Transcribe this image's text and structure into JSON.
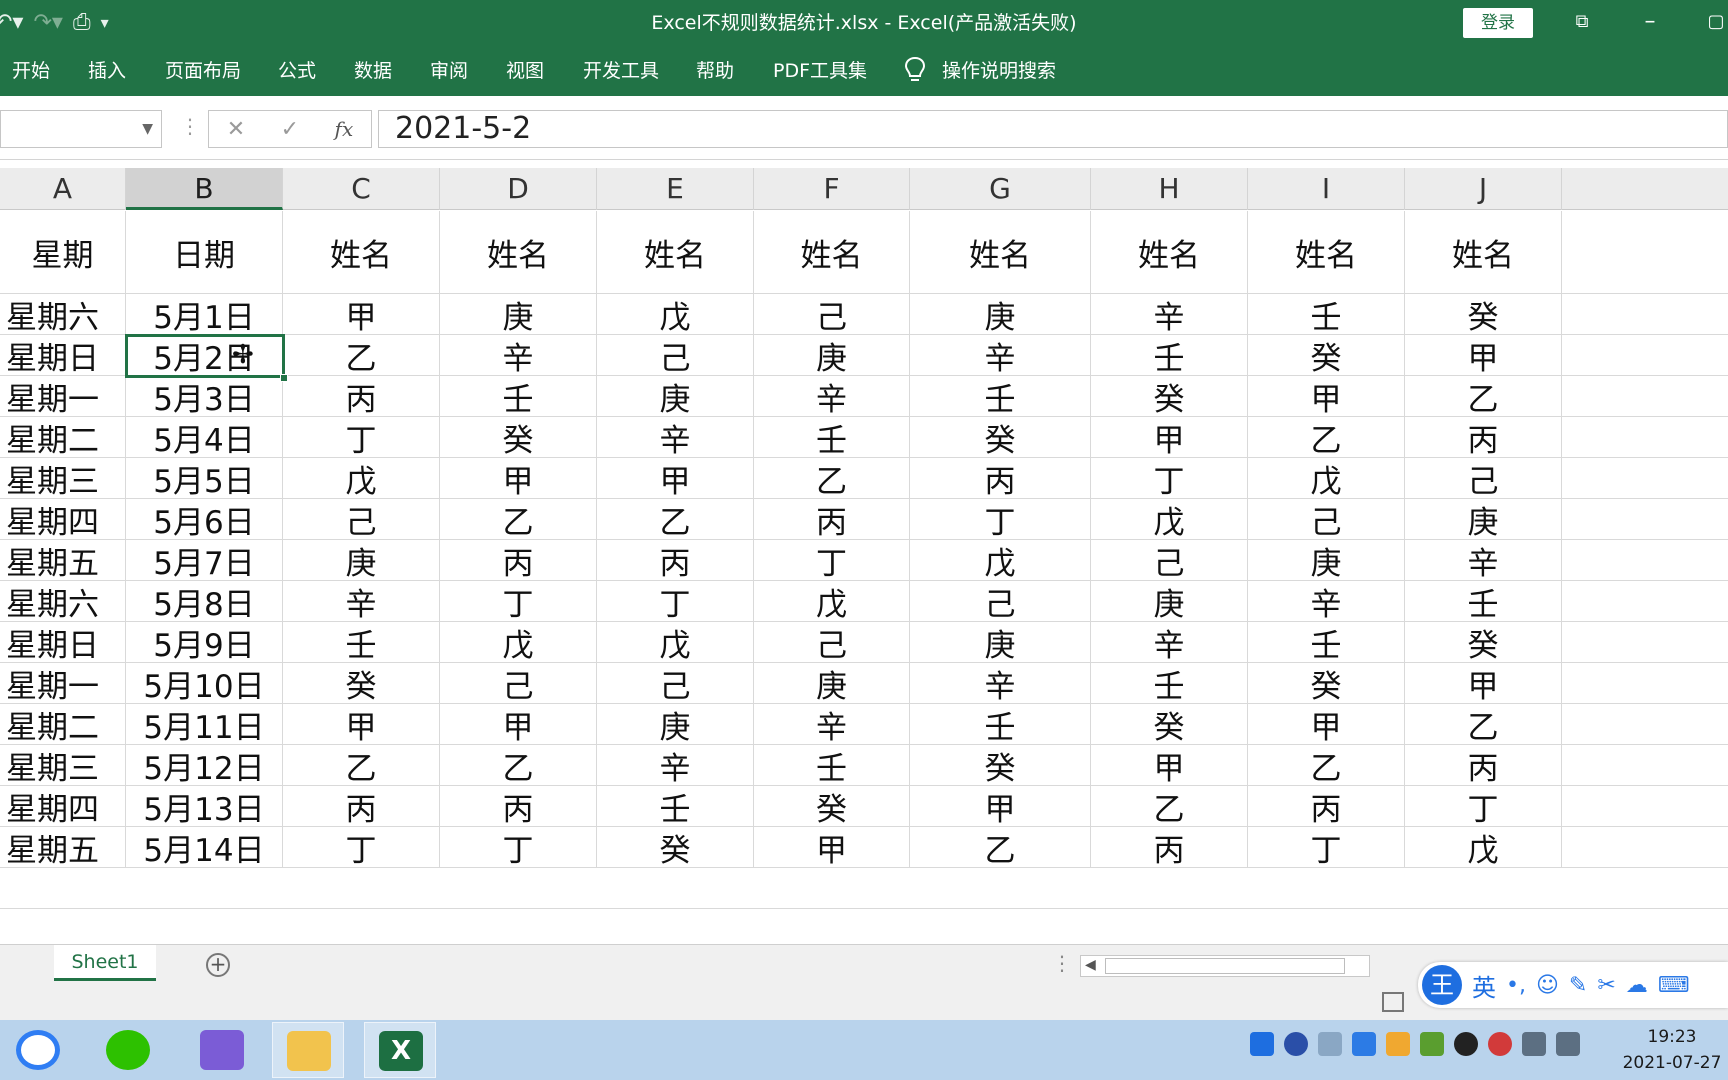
{
  "window": {
    "title": "Excel不规则数据统计.xlsx  -  Excel(产品激活失败)",
    "login_label": "登录",
    "colors": {
      "ribbon": "#217346",
      "accent": "#217346"
    }
  },
  "quick_access": [
    "undo-icon",
    "redo-icon",
    "print-preview-icon",
    "customize-qat-icon"
  ],
  "ribbon": {
    "tabs": [
      "开始",
      "插入",
      "页面布局",
      "公式",
      "数据",
      "审阅",
      "视图",
      "开发工具",
      "帮助",
      "PDF工具集"
    ],
    "tell_me": "操作说明搜索"
  },
  "formula_bar": {
    "name_box": "",
    "value": "2021-5-2",
    "fx": "fx"
  },
  "grid": {
    "columns": [
      "A",
      "B",
      "C",
      "D",
      "E",
      "F",
      "G",
      "H",
      "I",
      "J"
    ],
    "selected_column": "B",
    "header_row": [
      "星期",
      "日期",
      "姓名",
      "姓名",
      "姓名",
      "姓名",
      "姓名",
      "姓名",
      "姓名",
      "姓名"
    ],
    "rows": [
      [
        "星期六",
        "5月1日",
        "甲",
        "庚",
        "戊",
        "己",
        "庚",
        "辛",
        "壬",
        "癸"
      ],
      [
        "星期日",
        "5月2日",
        "乙",
        "辛",
        "己",
        "庚",
        "辛",
        "壬",
        "癸",
        "甲"
      ],
      [
        "星期一",
        "5月3日",
        "丙",
        "壬",
        "庚",
        "辛",
        "壬",
        "癸",
        "甲",
        "乙"
      ],
      [
        "星期二",
        "5月4日",
        "丁",
        "癸",
        "辛",
        "壬",
        "癸",
        "甲",
        "乙",
        "丙"
      ],
      [
        "星期三",
        "5月5日",
        "戊",
        "甲",
        "甲",
        "乙",
        "丙",
        "丁",
        "戊",
        "己"
      ],
      [
        "星期四",
        "5月6日",
        "己",
        "乙",
        "乙",
        "丙",
        "丁",
        "戊",
        "己",
        "庚"
      ],
      [
        "星期五",
        "5月7日",
        "庚",
        "丙",
        "丙",
        "丁",
        "戊",
        "己",
        "庚",
        "辛"
      ],
      [
        "星期六",
        "5月8日",
        "辛",
        "丁",
        "丁",
        "戊",
        "己",
        "庚",
        "辛",
        "壬"
      ],
      [
        "星期日",
        "5月9日",
        "壬",
        "戊",
        "戊",
        "己",
        "庚",
        "辛",
        "壬",
        "癸"
      ],
      [
        "星期一",
        "5月10日",
        "癸",
        "己",
        "己",
        "庚",
        "辛",
        "壬",
        "癸",
        "甲"
      ],
      [
        "星期二",
        "5月11日",
        "甲",
        "甲",
        "庚",
        "辛",
        "壬",
        "癸",
        "甲",
        "乙"
      ],
      [
        "星期三",
        "5月12日",
        "乙",
        "乙",
        "辛",
        "壬",
        "癸",
        "甲",
        "乙",
        "丙"
      ],
      [
        "星期四",
        "5月13日",
        "丙",
        "丙",
        "壬",
        "癸",
        "甲",
        "乙",
        "丙",
        "丁"
      ],
      [
        "星期五",
        "5月14日",
        "丁",
        "丁",
        "癸",
        "甲",
        "乙",
        "丙",
        "丁",
        "戊"
      ]
    ]
  },
  "sheets": [
    "Sheet1"
  ],
  "ime": {
    "logo": "王",
    "mode": "英",
    "icons": [
      "punctuation-icon",
      "emoji-icon",
      "pen-icon",
      "scissors-icon",
      "cloud-icon",
      "keyboard-icon"
    ]
  },
  "taskbar": {
    "apps": [
      "baidu-netdisk-icon",
      "wechat-icon",
      "game-center-icon",
      "file-explorer-icon",
      "excel-icon"
    ],
    "time": "19:23",
    "date": "2021-07-27"
  }
}
